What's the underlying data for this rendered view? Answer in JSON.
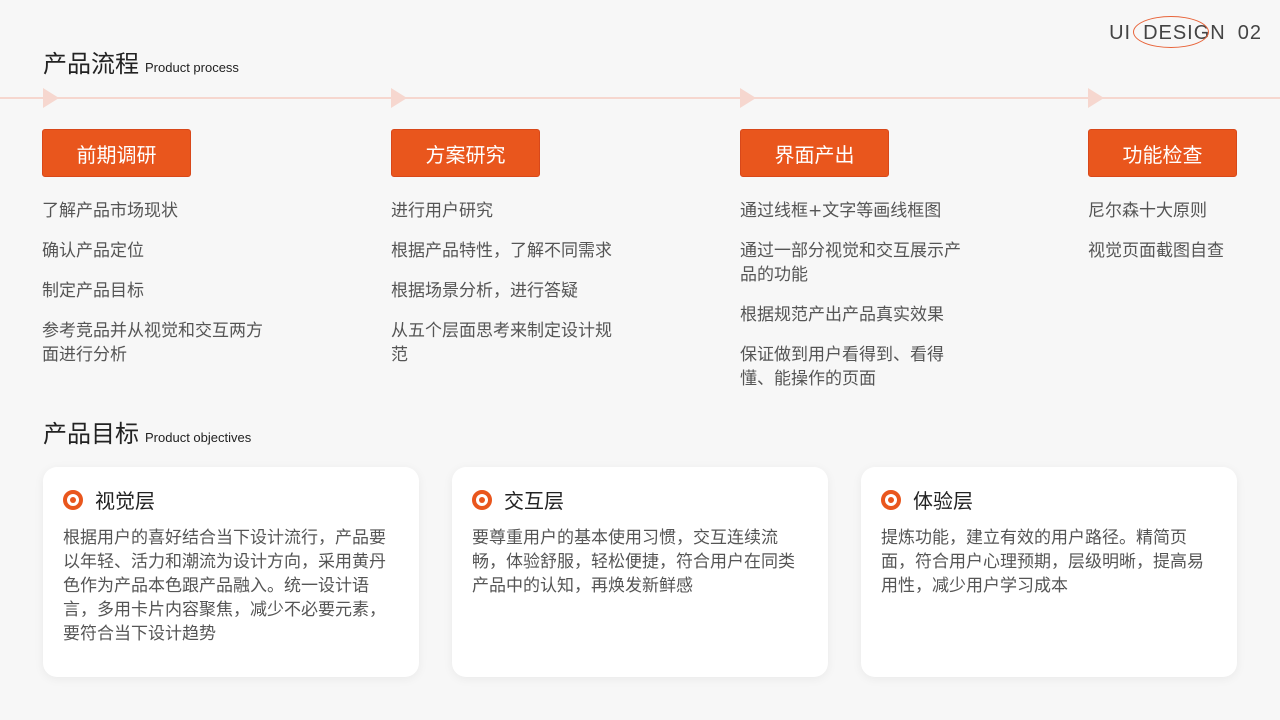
{
  "brand": {
    "prefix": "UI",
    "highlight": "DESIGN",
    "suffix": "02",
    "accent_color": "#e8643a"
  },
  "process": {
    "title_zh": "产品流程",
    "title_en": "Product process",
    "steps": [
      {
        "label": "前期调研",
        "items": [
          "了解产品市场现状",
          "确认产品定位",
          "制定产品目标",
          "参考竞品并从视觉和交互两方面进行分析"
        ]
      },
      {
        "label": "方案研究",
        "items": [
          "进行用户研究",
          "根据产品特性，了解不同需求",
          "根据场景分析，进行答疑",
          "从五个层面思考来制定设计规范"
        ]
      },
      {
        "label": "界面产出",
        "items": [
          "通过线框+文字等画线框图",
          "通过一部分视觉和交互展示产品的功能",
          "根据规范产出产品真实效果",
          "保证做到用户看得到、看得懂、能操作的页面"
        ]
      },
      {
        "label": "功能检查",
        "items": [
          "尼尔森十大原则",
          "视觉页面截图自查"
        ]
      }
    ]
  },
  "objectives": {
    "title_zh": "产品目标",
    "title_en": "Product objectives",
    "cards": [
      {
        "icon": "ring-icon",
        "title": "视觉层",
        "body": "根据用户的喜好结合当下设计流行，产品要以年轻、活力和潮流为设计方向，采用黄丹色作为产品本色跟产品融入。统一设计语言，多用卡片内容聚焦，减少不必要元素，要符合当下设计趋势"
      },
      {
        "icon": "ring-icon",
        "title": "交互层",
        "body": "要尊重用户的基本使用习惯，交互连续流畅，体验舒服，轻松便捷，符合用户在同类产品中的认知，再焕发新鲜感"
      },
      {
        "icon": "ring-icon",
        "title": "体验层",
        "body": "提炼功能，建立有效的用户路径。精简页面，符合用户心理预期，层级明晰，提高易用性，减少用户学习成本"
      }
    ]
  },
  "colors": {
    "primary": "#e9561d",
    "timeline": "#f6d7cf",
    "background": "#f7f7f7"
  }
}
